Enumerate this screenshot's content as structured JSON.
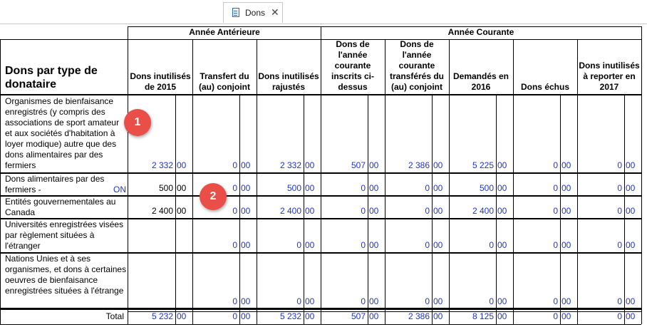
{
  "tab": {
    "label": "Dons",
    "close": "✕"
  },
  "header": {
    "main_title": "Dons par type de donataire",
    "group_prior": "Année Antérieure",
    "group_current": "Année Courante",
    "columns": [
      "Dons inutilisés de 2015",
      "Transfert du (au) conjoint",
      "Dons inutilisés rajustés",
      "Dons de l'année courante inscrits ci-dessus",
      "Dons de l'année courante transférés du (au) conjoint",
      "Demandés en 2016",
      "Dons échus",
      "Dons inutilisés à reporter en 2017"
    ]
  },
  "rows": [
    {
      "label": "Organismes de bienfaisance enregistrés (y compris des associations de sport amateur et aux sociétés d'habitation à loyer modique) autre que des dons alimentaires par des fermiers",
      "cells": [
        [
          "2 332",
          "00"
        ],
        [
          "0",
          "00"
        ],
        [
          "2 332",
          "00"
        ],
        [
          "507",
          "00"
        ],
        [
          "2 386",
          "00"
        ],
        [
          "5 225",
          "00"
        ],
        [
          "0",
          "00"
        ],
        [
          "0",
          "00"
        ]
      ]
    },
    {
      "label": "Dons alimentaires par des fermiers -",
      "link": "ON",
      "cells": [
        [
          "500",
          "00"
        ],
        [
          "0",
          "00"
        ],
        [
          "500",
          "00"
        ],
        [
          "0",
          "00"
        ],
        [
          "0",
          "00"
        ],
        [
          "500",
          "00"
        ],
        [
          "0",
          "00"
        ],
        [
          "0",
          "00"
        ]
      ]
    },
    {
      "label": "Entités gouvernementales au Canada",
      "cells": [
        [
          "2 400",
          "00"
        ],
        [
          "0",
          "00"
        ],
        [
          "2 400",
          "00"
        ],
        [
          "0",
          "00"
        ],
        [
          "0",
          "00"
        ],
        [
          "2 400",
          "00"
        ],
        [
          "0",
          "00"
        ],
        [
          "0",
          "00"
        ]
      ]
    },
    {
      "label": "Universités enregistrées visées par règlement situées à l'étranger",
      "cells": [
        [
          "",
          ""
        ],
        [
          "0",
          "00"
        ],
        [
          "0",
          "00"
        ],
        [
          "0",
          "00"
        ],
        [
          "0",
          "00"
        ],
        [
          "0",
          "00"
        ],
        [
          "0",
          "00"
        ],
        [
          "0",
          "00"
        ]
      ]
    },
    {
      "label": "Nations Unies et à ses organismes, et dons à certaines oeuvres de bienfaisance enregistrées situées à l'étrange",
      "cells": [
        [
          "",
          ""
        ],
        [
          "0",
          "00"
        ],
        [
          "0",
          "00"
        ],
        [
          "0",
          "00"
        ],
        [
          "0",
          "00"
        ],
        [
          "0",
          "00"
        ],
        [
          "0",
          "00"
        ],
        [
          "0",
          "00"
        ]
      ]
    }
  ],
  "total": {
    "label": "Total",
    "cells": [
      [
        "5 232",
        "00"
      ],
      [
        "0",
        "00"
      ],
      [
        "5 232",
        "00"
      ],
      [
        "507",
        "00"
      ],
      [
        "2 386",
        "00"
      ],
      [
        "8 125",
        "00"
      ],
      [
        "0",
        "00"
      ],
      [
        "0",
        "00"
      ]
    ]
  },
  "callouts": [
    "1",
    "2"
  ],
  "colors": {
    "value_blue": "#1f35c9",
    "badge_red": "#e94e48"
  }
}
